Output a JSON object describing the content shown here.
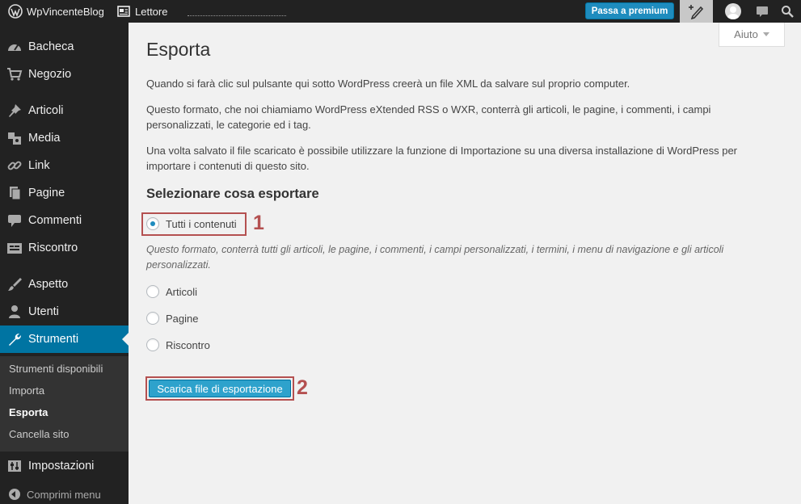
{
  "topbar": {
    "site_name": "WpVincenteBlog",
    "reader_label": "Lettore",
    "premium_button": "Passa a premium"
  },
  "sidebar": {
    "items": [
      {
        "label": "Bacheca",
        "icon": "dashboard-icon"
      },
      {
        "label": "Negozio",
        "icon": "cart-icon"
      },
      {
        "label": "Articoli",
        "icon": "pin-icon"
      },
      {
        "label": "Media",
        "icon": "media-icon"
      },
      {
        "label": "Link",
        "icon": "link-icon"
      },
      {
        "label": "Pagine",
        "icon": "pages-icon"
      },
      {
        "label": "Commenti",
        "icon": "comment-icon"
      },
      {
        "label": "Riscontro",
        "icon": "feedback-icon"
      },
      {
        "label": "Aspetto",
        "icon": "brush-icon"
      },
      {
        "label": "Utenti",
        "icon": "user-icon"
      },
      {
        "label": "Strumenti",
        "icon": "wrench-icon"
      },
      {
        "label": "Impostazioni",
        "icon": "settings-icon"
      }
    ],
    "submenu": [
      "Strumenti disponibili",
      "Importa",
      "Esporta",
      "Cancella sito"
    ],
    "collapse_label": "Comprimi menu"
  },
  "main": {
    "help_label": "Aiuto",
    "title": "Esporta",
    "para1": "Quando si farà clic sul pulsante qui sotto WordPress creerà un file XML da salvare sul proprio computer.",
    "para2": "Questo formato, che noi chiamiamo WordPress eXtended RSS o WXR, conterrà gli articoli, le pagine, i commenti, i campi personalizzati, le categorie ed i tag.",
    "para3": "Una volta salvato il file scaricato è possibile utilizzare la funzione di Importazione su una diversa installazione di WordPress per importare i contenuti di questo sito.",
    "section_title": "Selezionare cosa esportare",
    "options": [
      "Tutti i contenuti",
      "Articoli",
      "Pagine",
      "Riscontro"
    ],
    "selected_option": "Tutti i contenuti",
    "all_description": "Questo formato, conterrà tutti gli articoli, le pagine, i commenti, i campi personalizzati, i termini, i menu di navigazione e gli articoli personalizzati.",
    "export_button": "Scarica file di esportazione",
    "annotations": [
      "1",
      "2"
    ]
  },
  "colors": {
    "admin_bar": "#222222",
    "sidebar_active": "#0074a2",
    "button_primary": "#2ea2cc",
    "annotation": "#b45050"
  }
}
